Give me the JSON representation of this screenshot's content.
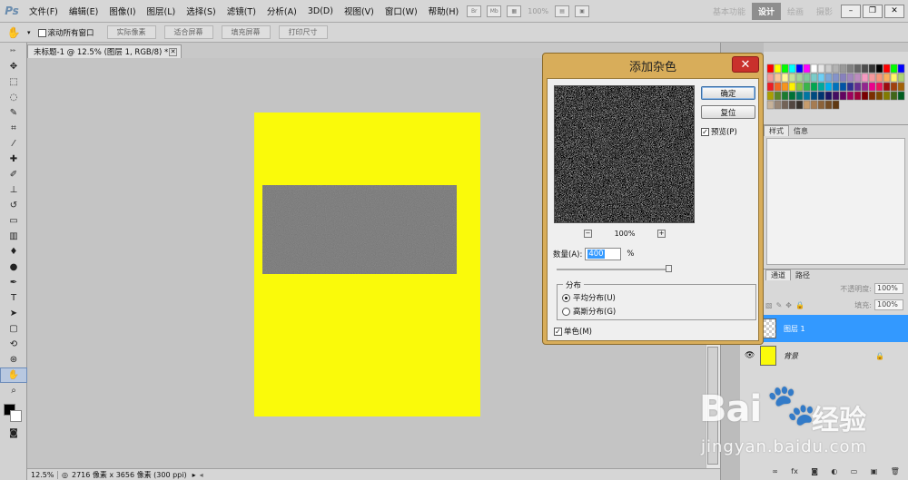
{
  "menubar": {
    "logo": "Ps",
    "items": [
      "文件(F)",
      "编辑(E)",
      "图像(I)",
      "图层(L)",
      "选择(S)",
      "滤镜(T)",
      "分析(A)",
      "3D(D)",
      "视图(V)",
      "窗口(W)",
      "帮助(H)"
    ],
    "zoom": "100%",
    "workspaces": [
      "基本功能",
      "设计",
      "绘画",
      "摄影"
    ],
    "active_workspace": "设计"
  },
  "optionsbar": {
    "scroll_all": "滚动所有窗口",
    "buttons": [
      "实际像素",
      "适合屏幕",
      "填充屏幕",
      "打印尺寸"
    ]
  },
  "document": {
    "tab_title": "未标题-1 @ 12.5% (图层 1, RGB/8) *",
    "bg_color": "#fafa0a"
  },
  "statusbar": {
    "zoom": "12.5%",
    "info": "2716 像素 x 3656 像素 (300 ppi)"
  },
  "panels": {
    "style_tabs": [
      "样式",
      "信息"
    ],
    "layer_tabs": [
      "通道",
      "路径"
    ],
    "opacity_label": "不透明度:",
    "opacity": "100%",
    "fill_label": "填充:",
    "fill": "100%",
    "layers": [
      {
        "name": "图层 1",
        "selected": true
      },
      {
        "name": "背景",
        "selected": false
      }
    ]
  },
  "dialog": {
    "title": "添加杂色",
    "ok": "确定",
    "reset": "复位",
    "preview_label": "预览(P)",
    "preview_checked": true,
    "zoom": "100%",
    "amount_label": "数量(A):",
    "amount_value": "400",
    "amount_unit": "%",
    "distribution_label": "分布",
    "uniform": "平均分布(U)",
    "gaussian": "高斯分布(G)",
    "selected_distribution": "uniform",
    "mono_label": "单色(M)",
    "mono_checked": true
  },
  "watermark": {
    "brand": "Bai",
    "brand2": "经验",
    "url": "jingyan.baidu.com"
  }
}
